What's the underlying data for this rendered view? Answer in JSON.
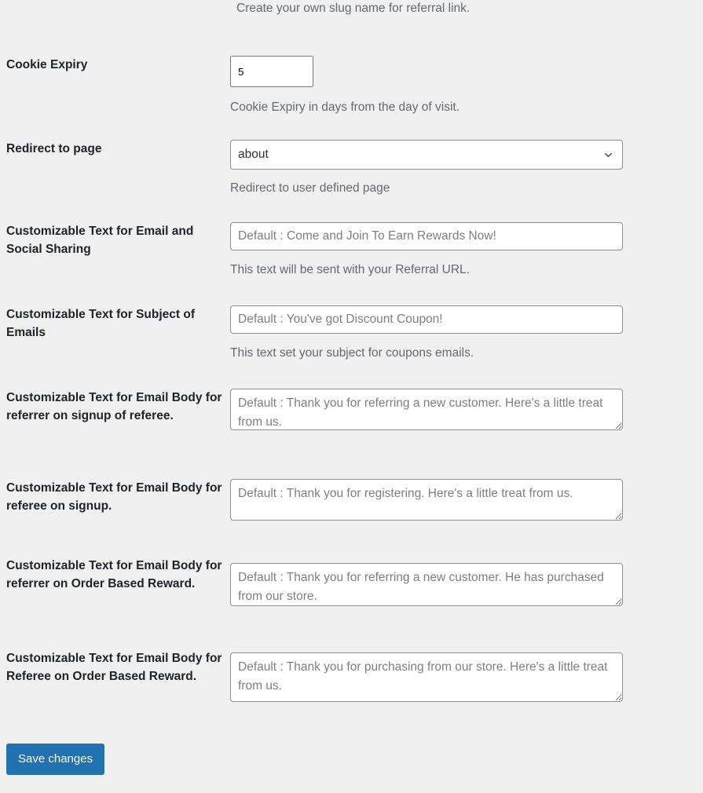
{
  "page": {
    "background_color": "#f0f0f1",
    "text_color": "#1d2327",
    "description_color": "#646970",
    "accent_color": "#2271b1",
    "input_border_color": "#8c8f94"
  },
  "top_partial_description": "Create your own slug name for referral link.",
  "rows": [
    {
      "label": "Cookie Expiry",
      "field_type": "number",
      "value": "5",
      "description": "Cookie Expiry in days from the day of visit."
    },
    {
      "label": "Redirect to page",
      "field_type": "select",
      "value": "about",
      "options": [
        "about"
      ],
      "description": "Redirect to user defined page"
    },
    {
      "label": "Customizable Text for Email and Social Sharing",
      "field_type": "text",
      "value": "",
      "placeholder": "Default : Come and Join To Earn Rewards Now!",
      "description": "This text will be sent with your Referral URL."
    },
    {
      "label": "Customizable Text for Subject of Emails",
      "field_type": "text",
      "value": "",
      "placeholder": "Default : You've got Discount Coupon!",
      "description": "This text set your subject for coupons emails."
    },
    {
      "label": "Customizable Text for Email Body for referrer on signup of referee.",
      "field_type": "textarea",
      "value": "",
      "placeholder": "Default : Thank you for referring a new customer. Here's a little treat from us.",
      "description": ""
    },
    {
      "label": "Customizable Text for Email Body for referee on signup.",
      "field_type": "textarea",
      "value": "",
      "placeholder": "Default : Thank you for registering. Here's a little treat from us.",
      "description": ""
    },
    {
      "label": "Customizable Text for Email Body for referrer on Order Based Reward.",
      "field_type": "textarea",
      "value": "",
      "placeholder": "Default : Thank you for referring a new customer. He has purchased from our store.",
      "description": ""
    },
    {
      "label": "Customizable Text for Email Body for Referee on Order Based Reward.",
      "field_type": "textarea",
      "value": "",
      "placeholder": "Default : Thank you for purchasing from our store. Here's a little treat from us.",
      "description": ""
    }
  ],
  "submit": {
    "save_label": "Save changes"
  },
  "icons": {
    "chevron_down": "chevron-down-icon",
    "resize_grip": "resize-grip-icon"
  }
}
